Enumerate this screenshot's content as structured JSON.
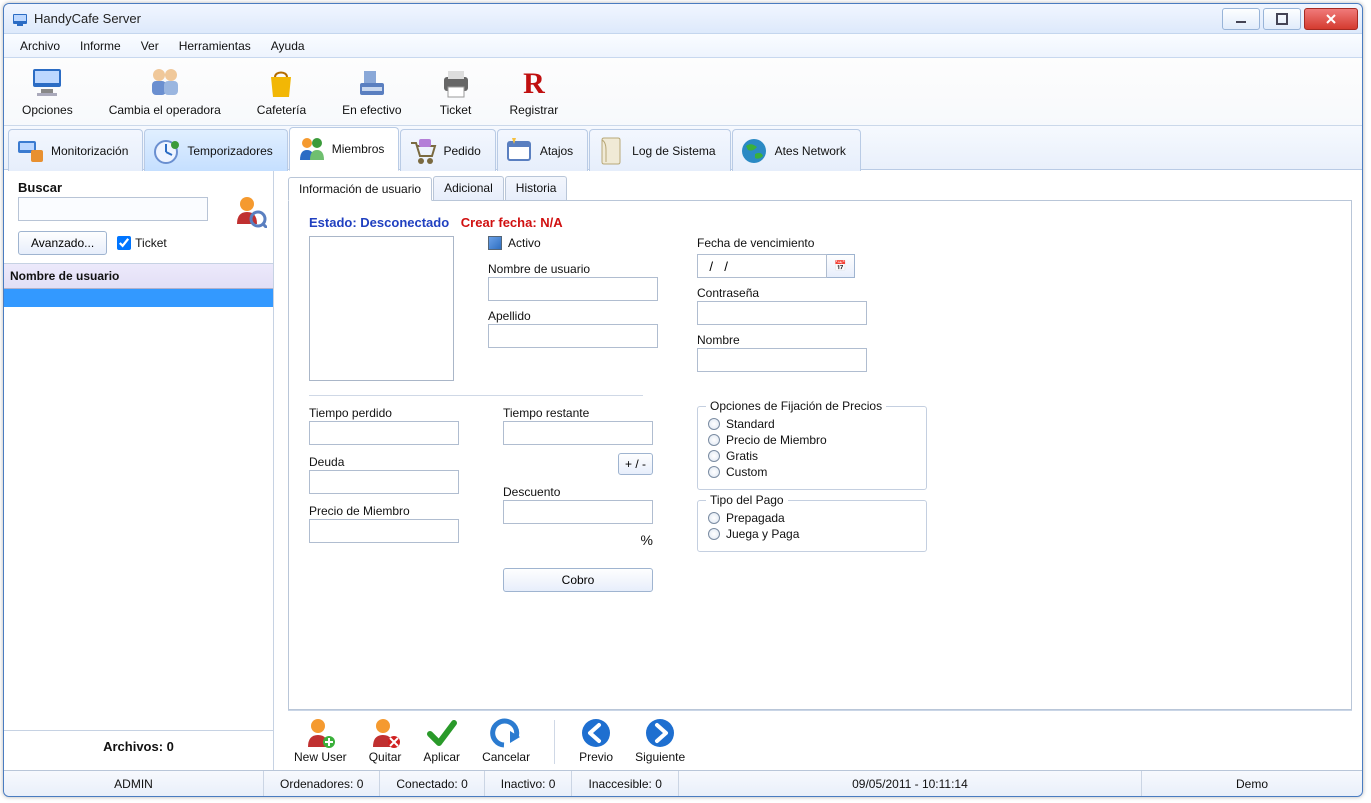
{
  "window": {
    "title": "HandyCafe Server"
  },
  "menubar": [
    "Archivo",
    "Informe",
    "Ver",
    "Herramientas",
    "Ayuda"
  ],
  "toolbar": [
    {
      "id": "options",
      "label": "Opciones"
    },
    {
      "id": "operator",
      "label": "Cambia el operadora"
    },
    {
      "id": "cafeteria",
      "label": "Cafetería"
    },
    {
      "id": "cash",
      "label": "En efectivo"
    },
    {
      "id": "ticket",
      "label": "Ticket"
    },
    {
      "id": "register",
      "label": "Registrar"
    }
  ],
  "navtabs": [
    {
      "id": "monitor",
      "label": "Monitorización"
    },
    {
      "id": "timers",
      "label": "Temporizadores"
    },
    {
      "id": "members",
      "label": "Miembros"
    },
    {
      "id": "order",
      "label": "Pedido"
    },
    {
      "id": "shortcuts",
      "label": "Atajos"
    },
    {
      "id": "syslog",
      "label": "Log de Sistema"
    },
    {
      "id": "ates",
      "label": "Ates Network"
    }
  ],
  "active_navtab": "members",
  "highlighted_navtab": "timers",
  "search": {
    "label": "Buscar",
    "value": "",
    "advanced_btn": "Avanzado...",
    "ticket_label": "Ticket",
    "ticket_checked": true
  },
  "user_list": {
    "header": "Nombre de usuario",
    "footer": "Archivos: 0"
  },
  "inner_tabs": [
    "Información de usuario",
    "Adicional",
    "Historia"
  ],
  "active_inner_tab": "Información de usuario",
  "userinfo": {
    "status_label": "Estado:",
    "status_value": "Desconectado",
    "create_label": "Crear fecha:",
    "create_value": "N/A",
    "active_label": "Activo",
    "fields": {
      "username_lbl": "Nombre de usuario",
      "password_lbl": "Contraseña",
      "lastname_lbl": "Apellido",
      "firstname_lbl": "Nombre",
      "expiry_lbl": "Fecha de vencimiento",
      "expiry_val": "  /   /",
      "timelost_lbl": "Tiempo perdido",
      "timeleft_lbl": "Tiempo restante",
      "plusminus": "+ / -",
      "debt_lbl": "Deuda",
      "discount_lbl": "Descuento",
      "memberprice_lbl": "Precio de Miembro",
      "charge_btn": "Cobro"
    },
    "pricing": {
      "legend": "Opciones de Fijación de Precios",
      "options": [
        "Standard",
        "Precio de Miembro",
        "Gratis",
        "Custom"
      ]
    },
    "paytype": {
      "legend": "Tipo del Pago",
      "options": [
        "Prepagada",
        "Juega y Paga"
      ]
    }
  },
  "actions": [
    {
      "id": "newuser",
      "label": "New User"
    },
    {
      "id": "remove",
      "label": "Quitar"
    },
    {
      "id": "apply",
      "label": "Aplicar"
    },
    {
      "id": "cancel",
      "label": "Cancelar"
    },
    {
      "id": "prev",
      "label": "Previo"
    },
    {
      "id": "next",
      "label": "Siguiente"
    }
  ],
  "statusbar": {
    "user": "ADMIN",
    "computers": "Ordenadores: 0",
    "connected": "Conectado: 0",
    "idle": "Inactivo: 0",
    "unreachable": "Inaccesible: 0",
    "datetime": "09/05/2011 - 10:11:14",
    "mode": "Demo"
  }
}
